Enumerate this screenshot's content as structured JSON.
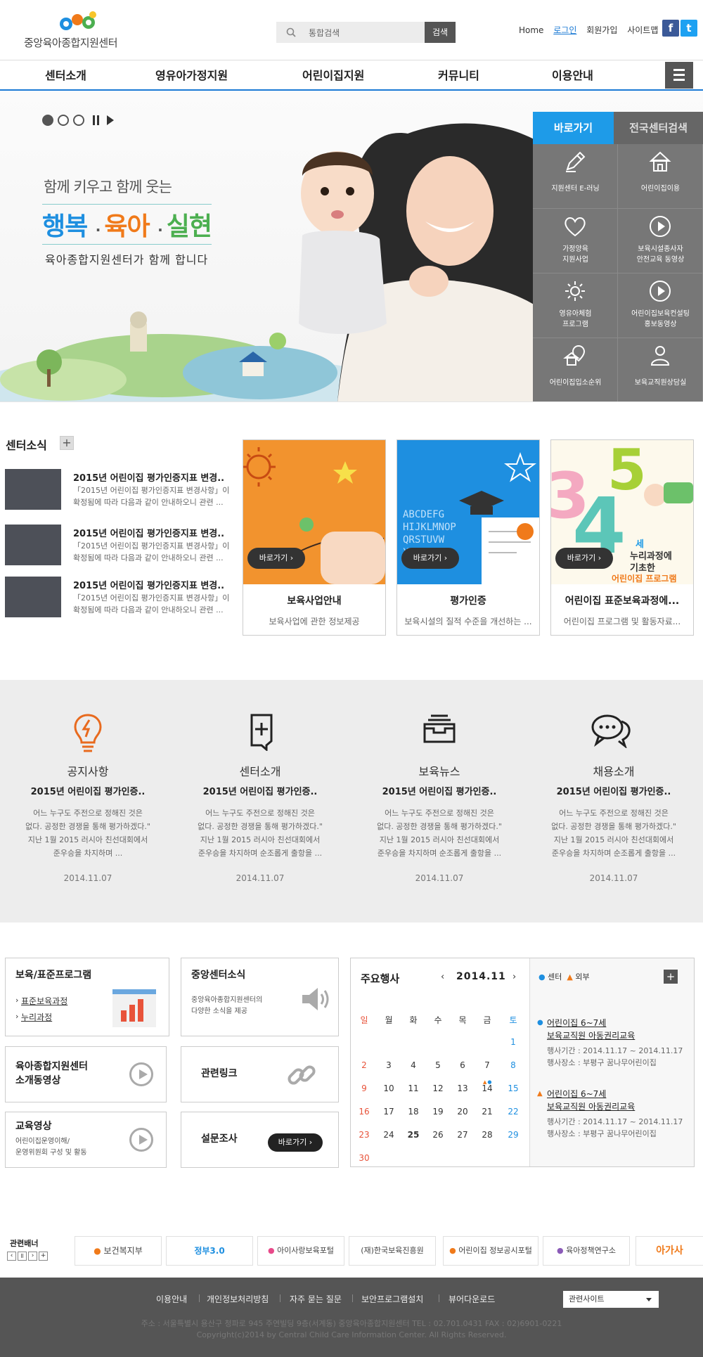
{
  "header": {
    "logo_text": "중앙육아종합지원센터",
    "search_placeholder": "통합검색",
    "search_button": "검색",
    "util_links": {
      "home": "Home",
      "login": "로그인",
      "join": "회원가입",
      "sitemap": "사이트맵"
    },
    "sns": {
      "facebook": "f",
      "twitter": "t"
    }
  },
  "gnb": [
    "센터소개",
    "영유아가정지원",
    "어린이집지원",
    "커뮤니티",
    "이용안내"
  ],
  "visual": {
    "slogan_top": "함께 키우고 함께 웃는",
    "slogan_words": [
      "행복",
      "육아",
      "실현"
    ],
    "slogan_bottom": "육아종합지원센터가 함께 합니다",
    "colors": {
      "blue": "#1e8fe0",
      "orange": "#f07a1a",
      "green": "#4caf50"
    }
  },
  "quick": {
    "tab_active": "바로가기",
    "tab_inactive": "전국센터검색",
    "items": [
      {
        "label": "지원센터 E-러닝",
        "icon": "pencil-icon"
      },
      {
        "label": "어린이집이용",
        "icon": "house-icon"
      },
      {
        "label": "가정양육\n지원사업",
        "icon": "heart-icon"
      },
      {
        "label": "보육시설종사자\n안전교육 동영상",
        "icon": "play-circle-icon"
      },
      {
        "label": "영유아체험\n프로그램",
        "icon": "gear-icon"
      },
      {
        "label": "어린이집보육컨설팅\n홍보동영상",
        "icon": "play-circle-icon"
      },
      {
        "label": "어린이집입소순위",
        "icon": "location-house-icon"
      },
      {
        "label": "보육교직원상담실",
        "icon": "person-icon"
      }
    ]
  },
  "center_news": {
    "title": "센터소식",
    "plus": "+",
    "items": [
      {
        "title": "2015년 어린이집 평가인증지표 변경..",
        "desc1": "「2015년 어린이집 평가인증지표 변경사항」이",
        "desc2": "확정됨에 따라 다음과 같이 안내하오니 관련 ..."
      },
      {
        "title": "2015년 어린이집 평가인증지표 변경..",
        "desc1": "「2015년 어린이집 평가인증지표 변경사항」이",
        "desc2": "확정됨에 따라 다음과 같이 안내하오니 관련 ..."
      },
      {
        "title": "2015년 어린이집 평가인증지표 변경..",
        "desc1": "「2015년 어린이집 평가인증지표 변경사항」이",
        "desc2": "확정됨에 따라 다음과 같이 안내하오니 관련 ..."
      }
    ]
  },
  "cards": [
    {
      "button": "바로가기",
      "title": "보육사업안내",
      "desc": "보육사업에 관한 정보제공"
    },
    {
      "button": "바로가기",
      "title": "평가인증",
      "desc": "보육시설의 질적 수준을 개선하는 ..."
    },
    {
      "button": "바로가기",
      "title": "어린이집 표준보육과정에...",
      "desc": "어린이집 프로그램 및 활동자료...",
      "art_text1": "세",
      "art_text2": "누리과정에",
      "art_text3": "기초한",
      "art_text4": "어린이집 프로그램"
    }
  ],
  "boards": [
    {
      "category": "공지사항",
      "title": "2015년 어린이집 평가인증..",
      "body": [
        "어느 누구도 주전으로 정해진 것은",
        "없다. 공정한 경쟁을 통해 평가하겠다.\"",
        "지난 1월 2015 러시아 친선대회에서",
        "준우승을 차지하며    ..."
      ],
      "date": "2014.11.07"
    },
    {
      "category": "센터소개",
      "title": "2015년 어린이집 평가인증..",
      "body": [
        "어느 누구도 주전으로 정해진 것은",
        "없다. 공정한 경쟁을 통해 평가하겠다.\"",
        "지난 1월 2015 러시아 친선대회에서",
        "준우승을 차지하며 순조롭게 출항을  ..."
      ],
      "date": "2014.11.07"
    },
    {
      "category": "보육뉴스",
      "title": "2015년 어린이집 평가인증..",
      "body": [
        "어느 누구도 주전으로 정해진 것은",
        "없다. 공정한 경쟁을 통해 평가하겠다.\"",
        "지난 1월 2015 러시아 친선대회에서",
        "준우승을 차지하며 순조롭게 출항을  ..."
      ],
      "date": "2014.11.07"
    },
    {
      "category": "채용소개",
      "title": "2015년 어린이집 평가인증..",
      "body": [
        "어느 누구도 주전으로 정해진 것은",
        "없다. 공정한 경쟁을 통해 평가하겠다.\"",
        "지난 1월 2015 러시아 친선대회에서",
        "준우승을 차지하며 순조롭게 출항을  ..."
      ],
      "date": "2014.11.07"
    }
  ],
  "program_box": {
    "title": "보육/표준프로그램",
    "links": [
      "표준보육과정",
      "누리과정"
    ]
  },
  "center_notice_box": {
    "title": "중앙센터소식",
    "desc": [
      "중앙육아종합지원센터의",
      "다양한 소식을 제공"
    ]
  },
  "video_box": {
    "title": [
      "육아종합지원센터",
      "소개동영상"
    ]
  },
  "link_box": {
    "title": "관련링크"
  },
  "edu_box": {
    "title": "교육영상",
    "desc": [
      "어린이집운영이해/",
      "운영위원회 구성 및 활동"
    ]
  },
  "survey_box": {
    "title": "설문조사",
    "button": "바로가기"
  },
  "calendar": {
    "title": "주요행사",
    "month": "2014.11",
    "prev": "‹",
    "next": "›",
    "weekdays": [
      "일",
      "월",
      "화",
      "수",
      "목",
      "금",
      "토"
    ],
    "weeks": [
      [
        "",
        "",
        "",
        "",
        "",
        "",
        "1"
      ],
      [
        "2",
        "3",
        "4",
        "5",
        "6",
        "7",
        "8"
      ],
      [
        "9",
        "10",
        "11",
        "12",
        "13",
        "14",
        "15"
      ],
      [
        "16",
        "17",
        "18",
        "19",
        "20",
        "21",
        "22"
      ],
      [
        "23",
        "24",
        "25",
        "26",
        "27",
        "28",
        "29"
      ],
      [
        "30",
        "",
        "",
        "",
        "",
        "",
        ""
      ]
    ],
    "legend_center": "센터",
    "legend_outside": "외부",
    "plus": "+",
    "events": [
      {
        "title1": "어린이집 6~7세",
        "title2": "보육교직원 아동권리교육",
        "period": "행사기간 : 2014.11.17 ~ 2014.11.17",
        "place": "행사장소 : 부평구 꿈나무어린이집"
      },
      {
        "title1": "어린이집 6~7세",
        "title2": "보육교직원 아동권리교육",
        "period": "행사기간 : 2014.11.17 ~ 2014.11.17",
        "place": "행사장소 : 부평구 꿈나무어린이집"
      }
    ]
  },
  "banners": {
    "title": "관련배너",
    "controls": [
      "‹",
      "ll",
      "›",
      "+"
    ],
    "items": [
      "보건복지부",
      "정부3.0",
      "아이사랑보육포털",
      "(재)한국보육진흥원",
      "어린이집 정보공시포털",
      "육아정책연구소",
      "아가사"
    ]
  },
  "footer": {
    "links": [
      "이용안내",
      "개인정보처리방침",
      "자주 묻는 질문",
      "보안프로그램설치",
      "뷰어다운로드"
    ],
    "select": "관련사이트",
    "address": "주소 : 서울특별시 용산구 청파로 945 주연빌딩 9층(서계동) 중앙육아종합지원센터     TEL : 02.701.0431   FAX : 02)6901-0221",
    "copyright": "Copyright(c)2014 by Central Child Care Information Center. All Rights Reserved."
  }
}
